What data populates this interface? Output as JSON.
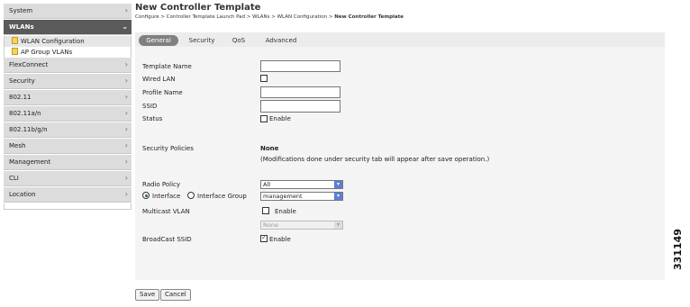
{
  "sidebar": {
    "items": [
      {
        "label": "System"
      },
      {
        "label": "WLANs"
      },
      {
        "label": "FlexConnect"
      },
      {
        "label": "Security"
      },
      {
        "label": "802.11"
      },
      {
        "label": "802.11a/n"
      },
      {
        "label": "802.11b/g/n"
      },
      {
        "label": "Mesh"
      },
      {
        "label": "Management"
      },
      {
        "label": "CLI"
      },
      {
        "label": "Location"
      }
    ],
    "sub_items": [
      {
        "label": "WLAN Configuration"
      },
      {
        "label": "AP Group VLANs"
      }
    ]
  },
  "header": {
    "title": "New Controller Template",
    "breadcrumb": [
      "Configure >",
      "Controller Template Launch Pad >",
      "WLANs >",
      "WLAN Configuration >",
      "New Controller Template"
    ]
  },
  "tabs": [
    {
      "label": "General"
    },
    {
      "label": "Security"
    },
    {
      "label": "QoS"
    },
    {
      "label": "Advanced"
    }
  ],
  "form": {
    "template_name": {
      "label": "Template Name",
      "value": ""
    },
    "wired_lan": {
      "label": "Wired LAN",
      "checked": false
    },
    "profile_name": {
      "label": "Profile Name",
      "value": ""
    },
    "ssid": {
      "label": "SSID",
      "value": ""
    },
    "status": {
      "label": "Status",
      "checkbox_label": "Enable",
      "checked": false
    },
    "security_policies": {
      "label": "Security Policies",
      "value": "None",
      "note": "(Modifications done under security tab will appear after save operation.)"
    },
    "radio_policy": {
      "label": "Radio Policy",
      "selected": "All"
    },
    "interface": {
      "option_interface": "Interface",
      "option_group": "Interface Group",
      "selected": "management"
    },
    "multicast_vlan": {
      "label": "Multicast VLAN",
      "checkbox_label": "Enable",
      "checked": false,
      "selected": "None"
    },
    "broadcast_ssid": {
      "label": "BroadCast SSID",
      "checkbox_label": "Enable",
      "checked": true
    }
  },
  "buttons": {
    "save": "Save",
    "cancel": "Cancel"
  },
  "figure_id": "331149"
}
